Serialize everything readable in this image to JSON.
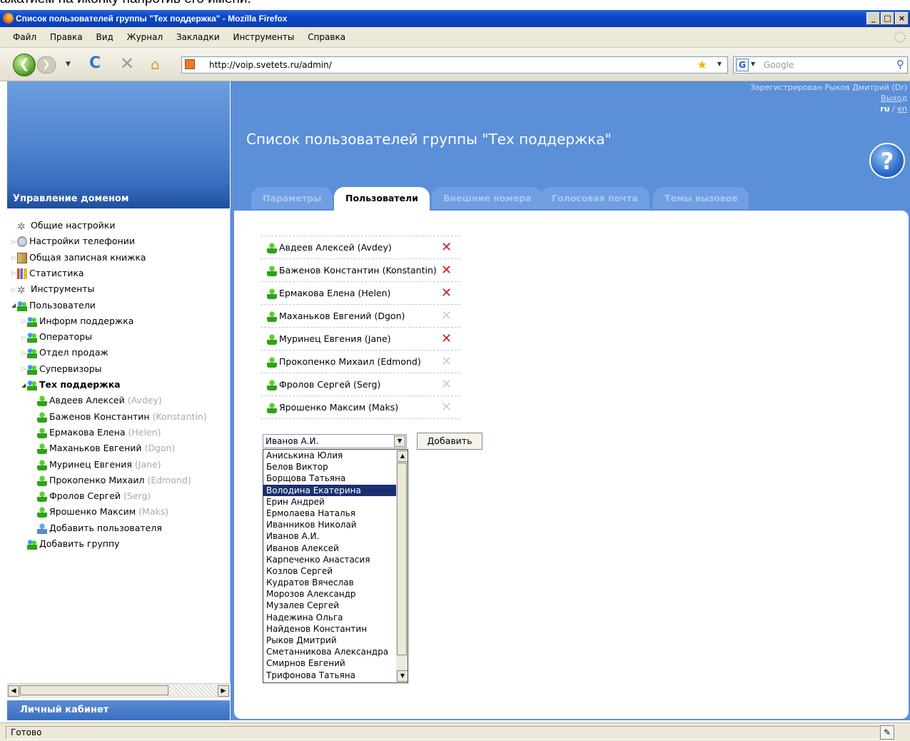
{
  "caption": "ажатием на иконку напротив его имени.",
  "window": {
    "title": "Список пользователей группы \"Тех поддержка\" - Mozilla Firefox",
    "buttons": [
      "_",
      "□",
      "×"
    ]
  },
  "menu": [
    "Файл",
    "Правка",
    "Вид",
    "Журнал",
    "Закладки",
    "Инструменты",
    "Справка"
  ],
  "nav": {
    "url": "http://voip.svetets.ru/admin/",
    "search_placeholder": "Google"
  },
  "left": {
    "header": "Управление доменом",
    "footer": "Личный кабинет",
    "tree": [
      {
        "label": "Общие настройки",
        "icon": "gears-icon",
        "level": 0,
        "toggle": "none"
      },
      {
        "label": "Настройки телефонии",
        "icon": "phone-icon",
        "level": 0,
        "toggle": "closed"
      },
      {
        "label": "Общая записная книжка",
        "icon": "book-icon",
        "level": 0,
        "toggle": "closed"
      },
      {
        "label": "Статистика",
        "icon": "stats-icon",
        "level": 0,
        "toggle": "closed"
      },
      {
        "label": "Инструменты",
        "icon": "tools-icon",
        "level": 0,
        "toggle": "closed"
      },
      {
        "label": "Пользователи",
        "icon": "users-icon",
        "level": 0,
        "toggle": "open"
      },
      {
        "label": "Информ поддержка",
        "icon": "users-icon",
        "level": 1,
        "toggle": "closed"
      },
      {
        "label": "Операторы",
        "icon": "users-icon",
        "level": 1,
        "toggle": "closed"
      },
      {
        "label": "Отдел продаж",
        "icon": "users-icon",
        "level": 1,
        "toggle": "closed"
      },
      {
        "label": "Супервизоры",
        "icon": "users-icon",
        "level": 1,
        "toggle": "closed"
      },
      {
        "label": "Тех поддержка",
        "icon": "users-icon",
        "level": 1,
        "toggle": "open",
        "bold": true
      },
      {
        "label": "Авдеев Алексей",
        "alias": "(Avdey)",
        "icon": "user-icon",
        "level": 2
      },
      {
        "label": "Баженов Константин",
        "alias": "(Konstantin)",
        "icon": "user-icon",
        "level": 2
      },
      {
        "label": "Ермакова Елена",
        "alias": "(Helen)",
        "icon": "user-icon",
        "level": 2
      },
      {
        "label": "Маханьков Евгений",
        "alias": "(Dgon)",
        "icon": "user-icon",
        "level": 2
      },
      {
        "label": "Муринец Евгения",
        "alias": "(Jane)",
        "icon": "user-icon",
        "level": 2
      },
      {
        "label": "Прокопенко Михаил",
        "alias": "(Edmond)",
        "icon": "user-icon",
        "level": 2
      },
      {
        "label": "Фролов Сергей",
        "alias": "(Serg)",
        "icon": "user-icon",
        "level": 2
      },
      {
        "label": "Ярошенко Максим",
        "alias": "(Maks)",
        "icon": "user-icon",
        "level": 2
      },
      {
        "label": "Добавить пользователя",
        "icon": "add-user-icon",
        "level": 2
      },
      {
        "label": "Добавить группу",
        "icon": "add-group-icon",
        "level": 0.5
      }
    ]
  },
  "header": {
    "registered": "Зарегистрирован Рыков Дмитрий (Dr)",
    "logout": "Выход",
    "lang_ru": "ru",
    "lang_sep": " / ",
    "lang_en": "en",
    "page_title": "Список пользователей группы \"Тех поддержка\"",
    "help": "?"
  },
  "tabs": [
    {
      "label": "Параметры",
      "active": false
    },
    {
      "label": "Пользователи",
      "active": true
    },
    {
      "label": "Внешние номера",
      "active": false
    },
    {
      "label": "Голосовая почта",
      "active": false
    },
    {
      "label": "Темы вызовов",
      "active": false
    }
  ],
  "members": [
    {
      "name": "Авдеев Алексей (Avdey)",
      "delete_active": true
    },
    {
      "name": "Баженов Константин (Konstantin)",
      "delete_active": true
    },
    {
      "name": "Ермакова Елена (Helen)",
      "delete_active": true
    },
    {
      "name": "Маханьков Евгений (Dgon)",
      "delete_active": false
    },
    {
      "name": "Муринец Евгения (Jane)",
      "delete_active": true
    },
    {
      "name": "Прокопенко Михаил (Edmond)",
      "delete_active": false
    },
    {
      "name": "Фролов Сергей (Serg)",
      "delete_active": false
    },
    {
      "name": "Ярошенко Максим (Maks)",
      "delete_active": false
    }
  ],
  "add_user": {
    "selected": "Иванов А.И.",
    "button": "Добавить",
    "highlighted": "Володина Екатерина",
    "options": [
      "Аниськина Юлия",
      "Белов Виктор",
      "Борщова Татьяна",
      "Володина Екатерина",
      "Ерин Андрей",
      "Ермолаева Наталья",
      "Иванников Николай",
      "Иванов А.И.",
      "Иванов Алексей",
      "Карпеченко Анастасия",
      "Козлов Сергей",
      "Кудратов Вячеслав",
      "Морозов Александр",
      "Музалев Сергей",
      "Надежина Ольга",
      "Найденов Константин",
      "Рыков Дмитрий",
      "Сметанникова Александра",
      "Смирнов Евгений",
      "Трифонова Татьяна"
    ]
  },
  "status": "Готово",
  "colors": {
    "accent": "#5b8fd8",
    "titlebar": "#0a46c8",
    "delete": "#d41a1a",
    "selection": "#1a3070"
  }
}
